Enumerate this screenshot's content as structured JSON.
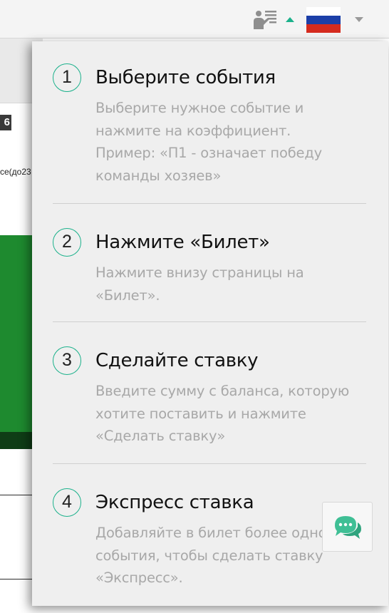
{
  "header": {
    "help_icon": "presentation-help-icon",
    "language_flag": "russia-flag",
    "flag_colors": [
      "#ffffff",
      "#1c3fa8",
      "#d52b1e"
    ],
    "accent_color": "#1bb18b"
  },
  "background": {
    "badge_text": "6",
    "partial_text": "се(до23"
  },
  "steps": [
    {
      "number": "1",
      "title": "Выберите события",
      "description": [
        "Выберите нужное событие и",
        "нажмите на коэффициент.",
        "Пример: «П1 - означает победу",
        "команды хозяев»"
      ]
    },
    {
      "number": "2",
      "title": "Нажмите «Билет»",
      "description": [
        "Нажмите внизу страницы на",
        "«Билет»."
      ]
    },
    {
      "number": "3",
      "title": "Сделайте ставку",
      "description": [
        "Введите сумму с баланса, которую",
        "хотите поставить и нажмите",
        "«Сделать ставку»"
      ]
    },
    {
      "number": "4",
      "title": "Экспресс ставка",
      "description": [
        "Добавляйте в билет более одного",
        "события, чтобы сделать ставку",
        "«Экспресс»."
      ]
    }
  ],
  "chat": {
    "icon": "chat-bubbles-icon",
    "color": "#3fbf95"
  }
}
